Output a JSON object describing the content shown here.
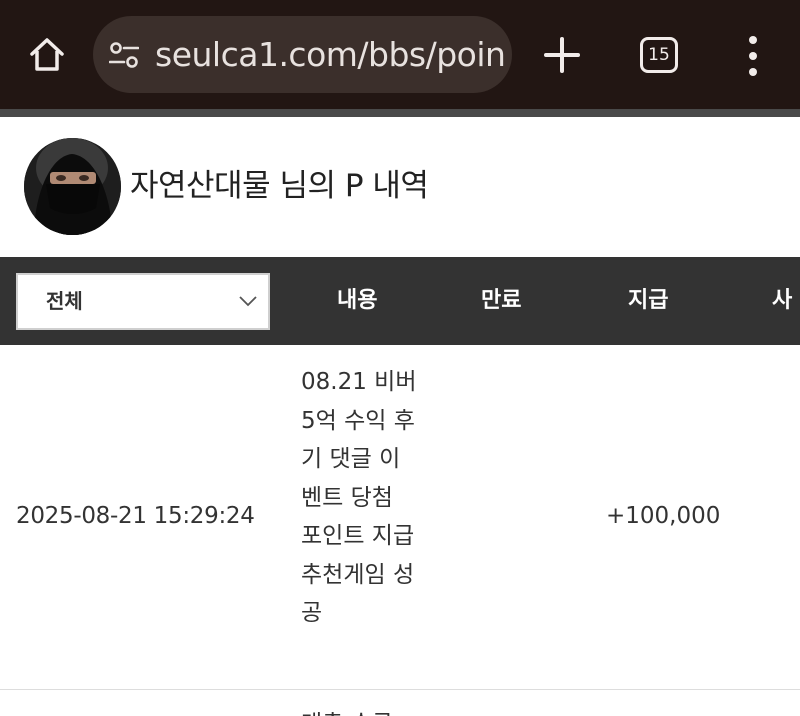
{
  "browser": {
    "url": "seulca1.com/bbs/poin",
    "tab_count": "15",
    "icons": [
      "home-icon",
      "site-settings-icon",
      "plus-icon",
      "tab-switcher-icon",
      "more-vert-icon"
    ]
  },
  "header": {
    "title": "자연산대물 님의 P 내역"
  },
  "table": {
    "filter": {
      "selected": "전체"
    },
    "columns": [
      "내용",
      "만료",
      "지급",
      "사"
    ],
    "rows": [
      {
        "date": "2025-08-21 15:29:24",
        "content": "08.21 비버 5억 수익 후기 댓글 이벤트 당첨 포인트 지급 추천게임 성공",
        "expire": "",
        "paid": "+100,000"
      },
      {
        "date": "",
        "content": "대출 수급",
        "expire": "",
        "paid": ""
      }
    ]
  },
  "colors": {
    "chrome_bg": "#221613",
    "url_pill": "#3b2f2b",
    "table_head": "#333333"
  }
}
